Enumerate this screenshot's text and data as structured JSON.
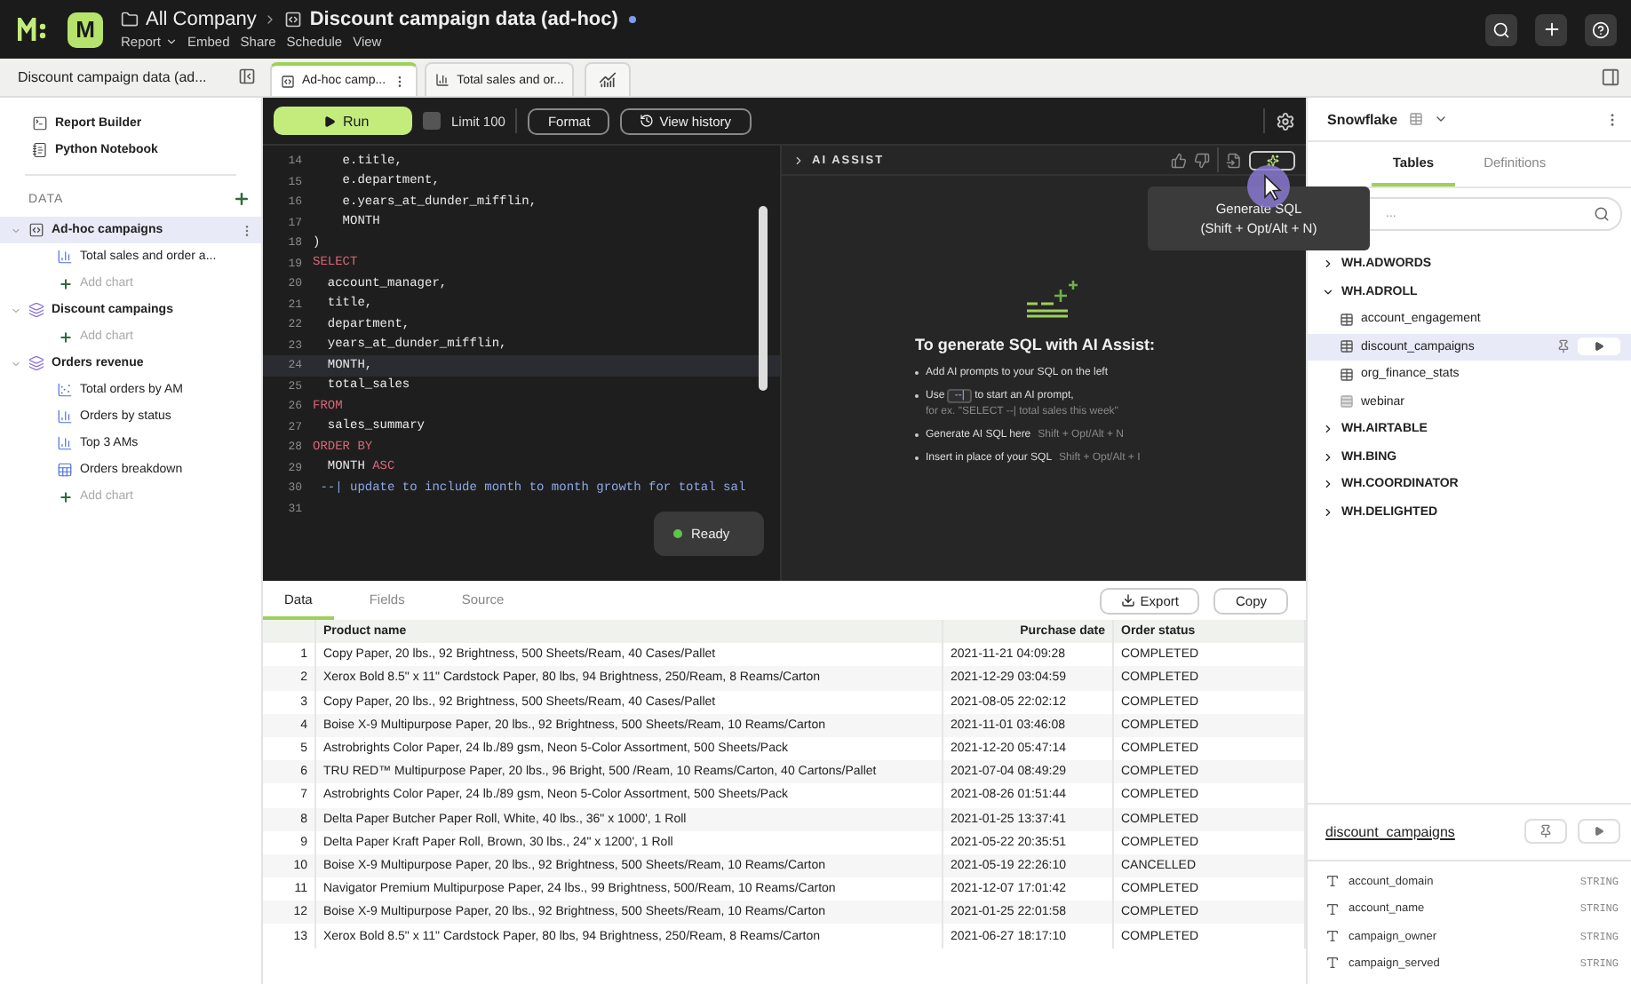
{
  "app": {
    "logo_letter": "M",
    "breadcrumb": [
      {
        "kind": "folder",
        "label": "All Company"
      },
      {
        "kind": "report",
        "label": "Discount campaign data (ad-hoc)",
        "unsaved": true
      }
    ],
    "menu": [
      {
        "label": "Report",
        "dropdown": true
      },
      {
        "label": "Embed",
        "dropdown": false
      },
      {
        "label": "Share",
        "dropdown": false
      },
      {
        "label": "Schedule",
        "dropdown": false
      },
      {
        "label": "View",
        "dropdown": false
      }
    ]
  },
  "sidebar": {
    "title": "Discount campaign data (ad...",
    "tools": [
      {
        "kind": "report",
        "label": "Report Builder"
      },
      {
        "kind": "notebook",
        "label": "Python Notebook"
      }
    ],
    "data_heading": "DATA",
    "datasets": [
      {
        "kind": "query",
        "label": "Ad-hoc campaigns",
        "expanded": true,
        "selected": true,
        "children": [
          {
            "kind": "chart",
            "label": "Total sales and order a..."
          }
        ],
        "add_label": "Add chart"
      },
      {
        "kind": "dataset",
        "label": "Discount campaings",
        "expanded": true,
        "selected": false,
        "add_label": "Add chart"
      },
      {
        "kind": "dataset",
        "label": "Orders revenue",
        "expanded": true,
        "selected": false,
        "children": [
          {
            "kind": "scatter",
            "label": "Total orders by AM"
          },
          {
            "kind": "chart",
            "label": "Orders by status"
          },
          {
            "kind": "chart",
            "label": "Top 3 AMs"
          },
          {
            "kind": "table",
            "label": "Orders breakdown"
          }
        ],
        "add_label": "Add chart"
      }
    ]
  },
  "editor_tabs": [
    {
      "kind": "query",
      "label": "Ad-hoc camp...",
      "selected": true
    },
    {
      "kind": "chart",
      "label": "Total sales and or...",
      "selected": false
    }
  ],
  "toolbar": {
    "run": "Run",
    "limit": {
      "label": "Limit 100",
      "checked": false
    },
    "format": "Format",
    "history": "View history"
  },
  "code": [
    {
      "number": "14",
      "tokens": [
        {
          "kind": "plain",
          "text": "    e.title,"
        }
      ]
    },
    {
      "number": "15",
      "tokens": [
        {
          "kind": "plain",
          "text": "    e.department,"
        }
      ]
    },
    {
      "number": "16",
      "tokens": [
        {
          "kind": "plain",
          "text": "    e.years_at_dunder_mifflin,"
        }
      ]
    },
    {
      "number": "17",
      "tokens": [
        {
          "kind": "plain",
          "text": "    MONTH"
        }
      ]
    },
    {
      "number": "18",
      "tokens": [
        {
          "kind": "plain",
          "text": ")"
        }
      ]
    },
    {
      "number": "19",
      "tokens": [
        {
          "kind": "keyword",
          "text": "SELECT"
        }
      ]
    },
    {
      "number": "20",
      "tokens": [
        {
          "kind": "plain",
          "text": "  account_manager,"
        }
      ]
    },
    {
      "number": "21",
      "tokens": [
        {
          "kind": "plain",
          "text": "  title,"
        }
      ]
    },
    {
      "number": "22",
      "tokens": [
        {
          "kind": "plain",
          "text": "  department,"
        }
      ]
    },
    {
      "number": "23",
      "tokens": [
        {
          "kind": "plain",
          "text": "  years_at_dunder_mifflin,"
        }
      ]
    },
    {
      "number": "24",
      "current": true,
      "tokens": [
        {
          "kind": "plain",
          "text": "  MONTH,"
        }
      ]
    },
    {
      "number": "25",
      "tokens": [
        {
          "kind": "plain",
          "text": "  total_sales"
        }
      ]
    },
    {
      "number": "26",
      "tokens": [
        {
          "kind": "keyword",
          "text": "FROM"
        }
      ]
    },
    {
      "number": "27",
      "tokens": [
        {
          "kind": "plain",
          "text": "  sales_summary"
        }
      ]
    },
    {
      "number": "28",
      "tokens": [
        {
          "kind": "keyword",
          "text": "ORDER BY"
        }
      ]
    },
    {
      "number": "29",
      "tokens": [
        {
          "kind": "plain",
          "text": "  MONTH "
        },
        {
          "kind": "keyword",
          "text": "ASC"
        }
      ]
    },
    {
      "number": "30",
      "tokens": [
        {
          "kind": "comment",
          "text": " --| update to include month to month growth for total sal"
        }
      ]
    },
    {
      "number": "31"
    }
  ],
  "status": "Ready",
  "ai_assist": {
    "title": "AI ASSIST",
    "heading": "To generate SQL with AI Assist:",
    "tips": [
      {
        "kind": "plain",
        "text": "Add AI prompts to your SQL on the left"
      },
      {
        "kind": "key",
        "before": "Use",
        "key": "--|",
        "after": "to start an AI prompt,",
        "example": "for ex. \"SELECT --| total sales this week\""
      },
      {
        "kind": "shortcut",
        "text": "Generate AI SQL here",
        "shortcut": "Shift + Opt/Alt + N"
      },
      {
        "kind": "shortcut",
        "text": "Insert in place of your SQL",
        "shortcut": "Shift + Opt/Alt + I"
      }
    ],
    "tooltip": {
      "title": "Generate SQL",
      "shortcut": "(Shift + Opt/Alt + N)"
    }
  },
  "results": {
    "tabs": [
      {
        "label": "Data",
        "selected": true
      },
      {
        "label": "Fields",
        "selected": false
      },
      {
        "label": "Source",
        "selected": false
      }
    ],
    "export": "Export",
    "copy": "Copy",
    "columns": [
      "",
      "Product name",
      "Purchase date",
      "Order status"
    ],
    "rows": [
      [
        "1",
        "Copy Paper, 20 lbs., 92 Brightness, 500 Sheets/Ream, 40 Cases/Pallet",
        "2021-11-21 04:09:28",
        "COMPLETED"
      ],
      [
        "2",
        "Xerox Bold 8.5\" x 11\" Cardstock Paper, 80 lbs, 94 Brightness, 250/Ream, 8 Reams/Carton",
        "2021-12-29 03:04:59",
        "COMPLETED"
      ],
      [
        "3",
        "Copy Paper, 20 lbs., 92 Brightness, 500 Sheets/Ream, 40 Cases/Pallet",
        "2021-08-05 22:02:12",
        "COMPLETED"
      ],
      [
        "4",
        "Boise X-9 Multipurpose Paper, 20 lbs., 92 Brightness, 500 Sheets/Ream, 10 Reams/Carton",
        "2021-11-01 03:46:08",
        "COMPLETED"
      ],
      [
        "5",
        "Astrobrights Color Paper, 24 lb./89 gsm, Neon 5-Color Assortment, 500 Sheets/Pack",
        "2021-12-20 05:47:14",
        "COMPLETED"
      ],
      [
        "6",
        "TRU RED™ Multipurpose Paper, 20 lbs., 96 Bright, 500 /Ream, 10 Reams/Carton, 40 Cartons/Pallet",
        "2021-07-04 08:49:29",
        "COMPLETED"
      ],
      [
        "7",
        "Astrobrights Color Paper, 24 lb./89 gsm, Neon 5-Color Assortment, 500 Sheets/Pack",
        "2021-08-26 01:51:44",
        "COMPLETED"
      ],
      [
        "8",
        "Delta Paper Butcher Paper Roll, White, 40 lbs., 36\" x 1000', 1 Roll",
        "2021-01-25 13:37:41",
        "COMPLETED"
      ],
      [
        "9",
        "Delta Paper Kraft Paper Roll, Brown, 30 lbs., 24\" x 1200', 1 Roll",
        "2021-05-22 20:35:51",
        "COMPLETED"
      ],
      [
        "10",
        "Boise X-9 Multipurpose Paper, 20 lbs., 92 Brightness, 500 Sheets/Ream, 10 Reams/Carton",
        "2021-05-19 22:26:10",
        "CANCELLED"
      ],
      [
        "11",
        "Navigator Premium Multipurpose Paper, 24 lbs., 99 Brightness, 500/Ream, 10 Reams/Carton",
        "2021-12-07 17:01:42",
        "COMPLETED"
      ],
      [
        "12",
        "Boise X-9 Multipurpose Paper, 20 lbs., 92 Brightness, 500 Sheets/Ream, 10 Reams/Carton",
        "2021-01-25 22:01:58",
        "COMPLETED"
      ],
      [
        "13",
        "Xerox Bold 8.5\" x 11\" Cardstock Paper, 80 lbs, 94 Brightness, 250/Ream, 8 Reams/Carton",
        "2021-06-27 18:17:10",
        "COMPLETED"
      ]
    ]
  },
  "schema_panel": {
    "connection": "Snowflake",
    "tabs": [
      {
        "label": "Tables",
        "selected": true
      },
      {
        "label": "Definitions",
        "selected": false
      }
    ],
    "search": {
      "placeholder": "..."
    },
    "schemas": [
      {
        "label": "WH.ADWORDS",
        "expanded": false
      },
      {
        "label": "WH.ADROLL",
        "expanded": true,
        "children": [
          {
            "kind": "table",
            "label": "account_engagement",
            "selected": false
          },
          {
            "kind": "table",
            "label": "discount_campaigns",
            "selected": true
          },
          {
            "kind": "table",
            "label": "org_finance_stats",
            "selected": false
          },
          {
            "kind": "view",
            "label": "webinar",
            "selected": false
          }
        ]
      },
      {
        "label": "WH.AIRTABLE",
        "expanded": false
      },
      {
        "label": "WH.BING",
        "expanded": false
      },
      {
        "label": "WH.COORDINATOR",
        "expanded": false
      },
      {
        "label": "WH.DELIGHTED",
        "expanded": false
      }
    ],
    "detail": {
      "table": "discount_campaigns",
      "fields": [
        {
          "name": "account_domain",
          "type": "STRING"
        },
        {
          "name": "account_name",
          "type": "STRING"
        },
        {
          "name": "campaign_owner",
          "type": "STRING"
        },
        {
          "name": "campaign_served",
          "type": "STRING"
        }
      ]
    }
  }
}
